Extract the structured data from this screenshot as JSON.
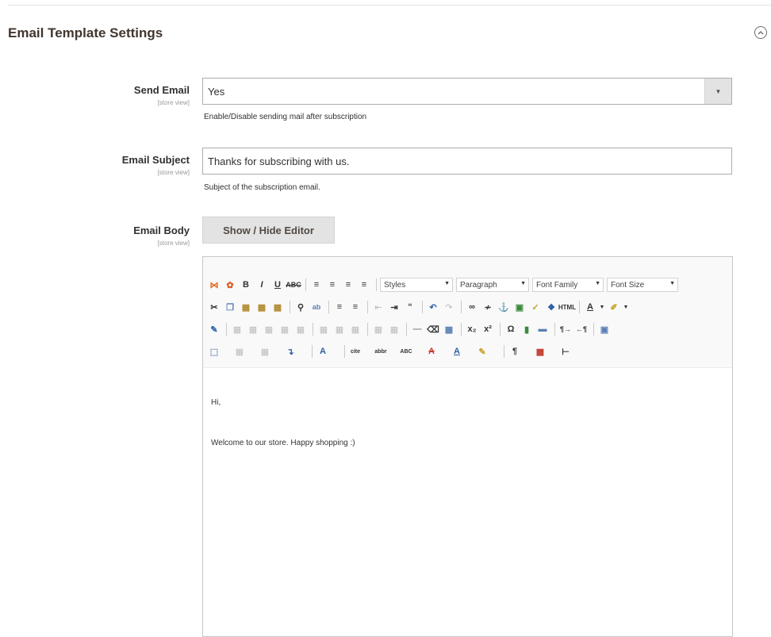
{
  "section": {
    "title": "Email Template Settings",
    "collapse_icon": "chevron-up-circle-icon"
  },
  "send_email": {
    "label": "Send Email",
    "scope": "[store view]",
    "value": "Yes",
    "note": "Enable/Disable sending mail after subscription"
  },
  "email_subject": {
    "label": "Email Subject",
    "scope": "[store view]",
    "value": "Thanks for subscribing with us.",
    "note": "Subject of the subscription email."
  },
  "email_body": {
    "label": "Email Body",
    "scope": "[store view]",
    "toggle_label": "Show / Hide Editor",
    "toolbar": {
      "styles": "Styles",
      "paragraph": "Paragraph",
      "font_family": "Font Family",
      "font_size": "Font Size"
    },
    "content_line1": "Hi,",
    "content_line2": "Welcome to our store. Happy shopping :)"
  }
}
